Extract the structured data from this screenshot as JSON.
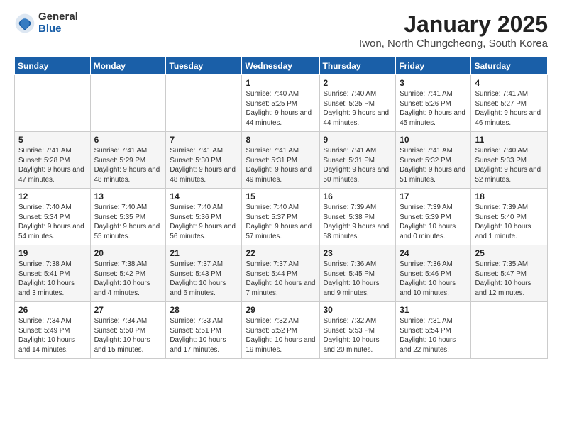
{
  "header": {
    "logo_general": "General",
    "logo_blue": "Blue",
    "month_title": "January 2025",
    "subtitle": "Iwon, North Chungcheong, South Korea"
  },
  "weekdays": [
    "Sunday",
    "Monday",
    "Tuesday",
    "Wednesday",
    "Thursday",
    "Friday",
    "Saturday"
  ],
  "weeks": [
    [
      {
        "day": "",
        "sunrise": "",
        "sunset": "",
        "daylight": ""
      },
      {
        "day": "",
        "sunrise": "",
        "sunset": "",
        "daylight": ""
      },
      {
        "day": "",
        "sunrise": "",
        "sunset": "",
        "daylight": ""
      },
      {
        "day": "1",
        "sunrise": "Sunrise: 7:40 AM",
        "sunset": "Sunset: 5:25 PM",
        "daylight": "Daylight: 9 hours and 44 minutes."
      },
      {
        "day": "2",
        "sunrise": "Sunrise: 7:40 AM",
        "sunset": "Sunset: 5:25 PM",
        "daylight": "Daylight: 9 hours and 44 minutes."
      },
      {
        "day": "3",
        "sunrise": "Sunrise: 7:41 AM",
        "sunset": "Sunset: 5:26 PM",
        "daylight": "Daylight: 9 hours and 45 minutes."
      },
      {
        "day": "4",
        "sunrise": "Sunrise: 7:41 AM",
        "sunset": "Sunset: 5:27 PM",
        "daylight": "Daylight: 9 hours and 46 minutes."
      }
    ],
    [
      {
        "day": "5",
        "sunrise": "Sunrise: 7:41 AM",
        "sunset": "Sunset: 5:28 PM",
        "daylight": "Daylight: 9 hours and 47 minutes."
      },
      {
        "day": "6",
        "sunrise": "Sunrise: 7:41 AM",
        "sunset": "Sunset: 5:29 PM",
        "daylight": "Daylight: 9 hours and 48 minutes."
      },
      {
        "day": "7",
        "sunrise": "Sunrise: 7:41 AM",
        "sunset": "Sunset: 5:30 PM",
        "daylight": "Daylight: 9 hours and 48 minutes."
      },
      {
        "day": "8",
        "sunrise": "Sunrise: 7:41 AM",
        "sunset": "Sunset: 5:31 PM",
        "daylight": "Daylight: 9 hours and 49 minutes."
      },
      {
        "day": "9",
        "sunrise": "Sunrise: 7:41 AM",
        "sunset": "Sunset: 5:31 PM",
        "daylight": "Daylight: 9 hours and 50 minutes."
      },
      {
        "day": "10",
        "sunrise": "Sunrise: 7:41 AM",
        "sunset": "Sunset: 5:32 PM",
        "daylight": "Daylight: 9 hours and 51 minutes."
      },
      {
        "day": "11",
        "sunrise": "Sunrise: 7:40 AM",
        "sunset": "Sunset: 5:33 PM",
        "daylight": "Daylight: 9 hours and 52 minutes."
      }
    ],
    [
      {
        "day": "12",
        "sunrise": "Sunrise: 7:40 AM",
        "sunset": "Sunset: 5:34 PM",
        "daylight": "Daylight: 9 hours and 54 minutes."
      },
      {
        "day": "13",
        "sunrise": "Sunrise: 7:40 AM",
        "sunset": "Sunset: 5:35 PM",
        "daylight": "Daylight: 9 hours and 55 minutes."
      },
      {
        "day": "14",
        "sunrise": "Sunrise: 7:40 AM",
        "sunset": "Sunset: 5:36 PM",
        "daylight": "Daylight: 9 hours and 56 minutes."
      },
      {
        "day": "15",
        "sunrise": "Sunrise: 7:40 AM",
        "sunset": "Sunset: 5:37 PM",
        "daylight": "Daylight: 9 hours and 57 minutes."
      },
      {
        "day": "16",
        "sunrise": "Sunrise: 7:39 AM",
        "sunset": "Sunset: 5:38 PM",
        "daylight": "Daylight: 9 hours and 58 minutes."
      },
      {
        "day": "17",
        "sunrise": "Sunrise: 7:39 AM",
        "sunset": "Sunset: 5:39 PM",
        "daylight": "Daylight: 10 hours and 0 minutes."
      },
      {
        "day": "18",
        "sunrise": "Sunrise: 7:39 AM",
        "sunset": "Sunset: 5:40 PM",
        "daylight": "Daylight: 10 hours and 1 minute."
      }
    ],
    [
      {
        "day": "19",
        "sunrise": "Sunrise: 7:38 AM",
        "sunset": "Sunset: 5:41 PM",
        "daylight": "Daylight: 10 hours and 3 minutes."
      },
      {
        "day": "20",
        "sunrise": "Sunrise: 7:38 AM",
        "sunset": "Sunset: 5:42 PM",
        "daylight": "Daylight: 10 hours and 4 minutes."
      },
      {
        "day": "21",
        "sunrise": "Sunrise: 7:37 AM",
        "sunset": "Sunset: 5:43 PM",
        "daylight": "Daylight: 10 hours and 6 minutes."
      },
      {
        "day": "22",
        "sunrise": "Sunrise: 7:37 AM",
        "sunset": "Sunset: 5:44 PM",
        "daylight": "Daylight: 10 hours and 7 minutes."
      },
      {
        "day": "23",
        "sunrise": "Sunrise: 7:36 AM",
        "sunset": "Sunset: 5:45 PM",
        "daylight": "Daylight: 10 hours and 9 minutes."
      },
      {
        "day": "24",
        "sunrise": "Sunrise: 7:36 AM",
        "sunset": "Sunset: 5:46 PM",
        "daylight": "Daylight: 10 hours and 10 minutes."
      },
      {
        "day": "25",
        "sunrise": "Sunrise: 7:35 AM",
        "sunset": "Sunset: 5:47 PM",
        "daylight": "Daylight: 10 hours and 12 minutes."
      }
    ],
    [
      {
        "day": "26",
        "sunrise": "Sunrise: 7:34 AM",
        "sunset": "Sunset: 5:49 PM",
        "daylight": "Daylight: 10 hours and 14 minutes."
      },
      {
        "day": "27",
        "sunrise": "Sunrise: 7:34 AM",
        "sunset": "Sunset: 5:50 PM",
        "daylight": "Daylight: 10 hours and 15 minutes."
      },
      {
        "day": "28",
        "sunrise": "Sunrise: 7:33 AM",
        "sunset": "Sunset: 5:51 PM",
        "daylight": "Daylight: 10 hours and 17 minutes."
      },
      {
        "day": "29",
        "sunrise": "Sunrise: 7:32 AM",
        "sunset": "Sunset: 5:52 PM",
        "daylight": "Daylight: 10 hours and 19 minutes."
      },
      {
        "day": "30",
        "sunrise": "Sunrise: 7:32 AM",
        "sunset": "Sunset: 5:53 PM",
        "daylight": "Daylight: 10 hours and 20 minutes."
      },
      {
        "day": "31",
        "sunrise": "Sunrise: 7:31 AM",
        "sunset": "Sunset: 5:54 PM",
        "daylight": "Daylight: 10 hours and 22 minutes."
      },
      {
        "day": "",
        "sunrise": "",
        "sunset": "",
        "daylight": ""
      }
    ]
  ]
}
